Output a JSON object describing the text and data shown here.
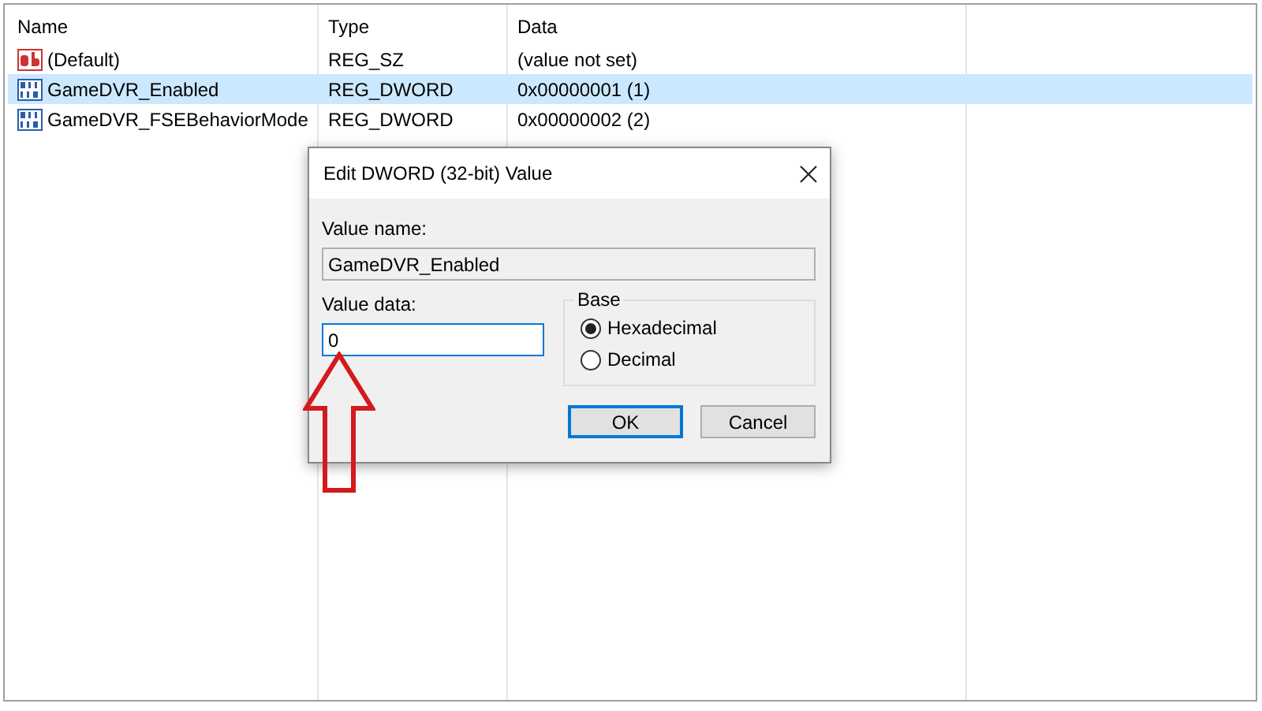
{
  "columns": [
    "Name",
    "Type",
    "Data"
  ],
  "rows": [
    {
      "kind": "string",
      "name": "(Default)",
      "type": "REG_SZ",
      "data": "(value not set)",
      "selected": false
    },
    {
      "kind": "binary",
      "name": "GameDVR_Enabled",
      "type": "REG_DWORD",
      "data": "0x00000001 (1)",
      "selected": true
    },
    {
      "kind": "binary",
      "name": "GameDVR_FSEBehaviorMode",
      "type": "REG_DWORD",
      "data": "0x00000002 (2)",
      "selected": false
    }
  ],
  "dialog": {
    "title": "Edit DWORD (32-bit) Value",
    "value_name_label": "Value name:",
    "value_name": "GameDVR_Enabled",
    "value_data_label": "Value data:",
    "value_data": "0",
    "base_label": "Base",
    "bases": [
      {
        "label": "Hexadecimal",
        "selected": true
      },
      {
        "label": "Decimal",
        "selected": false
      }
    ],
    "buttons": [
      {
        "label": "OK",
        "default": true
      },
      {
        "label": "Cancel",
        "default": false
      }
    ]
  }
}
